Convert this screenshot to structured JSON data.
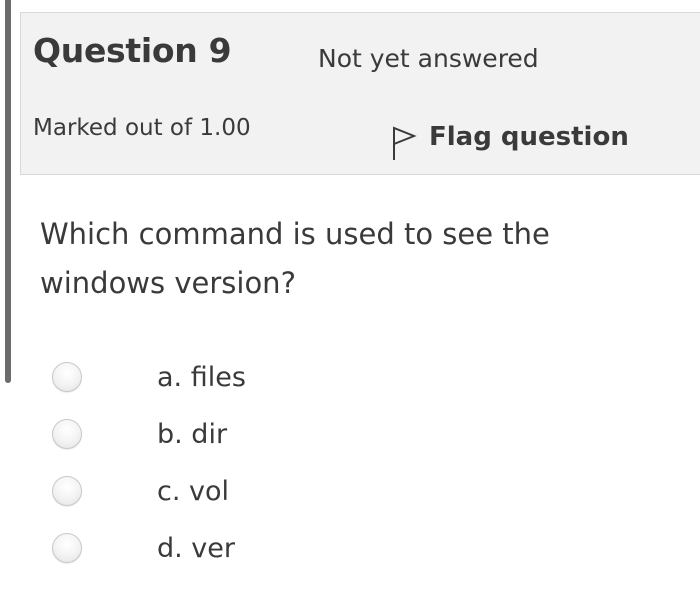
{
  "question": {
    "title": "Question 9",
    "state": "Not yet answered",
    "grade": "Marked out of 1.00",
    "flag_label": "Flag question",
    "text": "Which command is used to see the windows version?",
    "answers": [
      {
        "label": "a. files"
      },
      {
        "label": "b. dir"
      },
      {
        "label": "c. vol"
      },
      {
        "label": "d. ver"
      }
    ]
  },
  "icons": {
    "flag": "flag-outline-icon",
    "radio": "radio-unchecked"
  }
}
